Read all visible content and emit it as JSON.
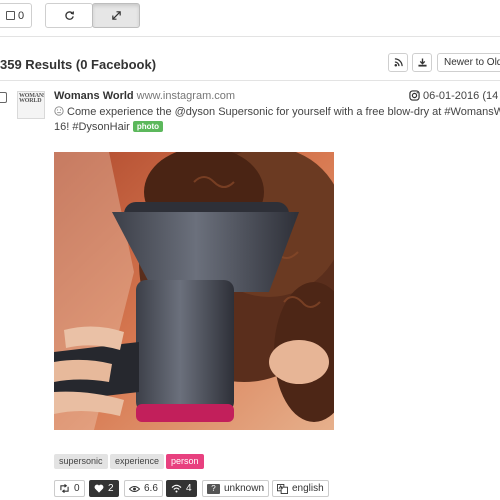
{
  "toolbar": {
    "select_count": "0",
    "refresh_icon": "refresh-icon",
    "expand_icon": "expand-icon"
  },
  "results": {
    "summary": "359 Results (0 Facebook)",
    "rss_icon": "rss-icon",
    "download_icon": "download-icon",
    "sort_label": "Newer to Old"
  },
  "post": {
    "avatar_text": "WOMANS WORLD",
    "author": "Womans World",
    "domain": "www.instagram.com",
    "date": "06-01-2016 (14",
    "text_line1": "Come experience the @dyson Supersonic for yourself with a free blow-dry at #WomansWorld",
    "text_line2": "16! #DysonHair",
    "media_label": "photo",
    "tags": [
      "supersonic",
      "experience",
      "person"
    ],
    "stats": {
      "retweets": "0",
      "likes": "2",
      "views": "6.6",
      "signal": "4",
      "sentiment": "unknown",
      "language": "english"
    }
  },
  "colors": {
    "photo_label": "#5cb85c",
    "person_tag": "#e8407f",
    "dark_stat": "#333333"
  }
}
